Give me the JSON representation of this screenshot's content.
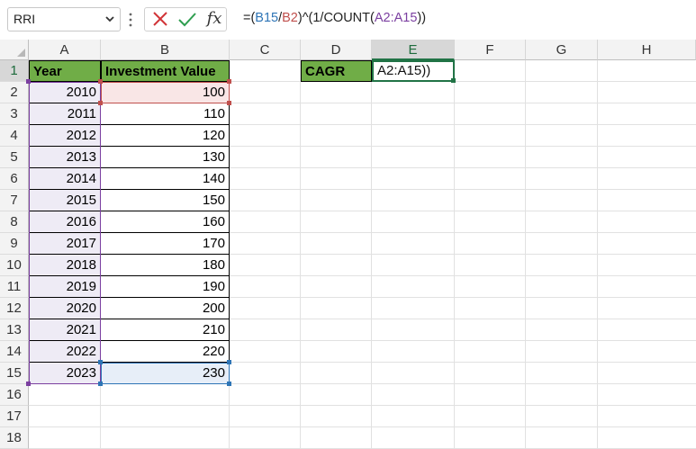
{
  "name_box": {
    "value": "RRI"
  },
  "formula_bar": {
    "fx_label": "fx",
    "formula_parts": [
      {
        "text": "=(",
        "color": "#222222"
      },
      {
        "text": "B15",
        "color": "#2e75b6"
      },
      {
        "text": "/",
        "color": "#222222"
      },
      {
        "text": "B2",
        "color": "#c0504d"
      },
      {
        "text": ")^(1/COUNT(",
        "color": "#222222"
      },
      {
        "text": "A2:A15",
        "color": "#7b3fa0"
      },
      {
        "text": "))",
        "color": "#222222"
      }
    ]
  },
  "columns": [
    "A",
    "B",
    "C",
    "D",
    "E",
    "F",
    "G",
    "H"
  ],
  "selected_column": "E",
  "rows": [
    "1",
    "2",
    "3",
    "4",
    "5",
    "6",
    "7",
    "8",
    "9",
    "10",
    "11",
    "12",
    "13",
    "14",
    "15",
    "16",
    "17",
    "18"
  ],
  "selected_row": "1",
  "table": {
    "headers": [
      "Year",
      "Investment Value"
    ],
    "years": [
      "2010",
      "2011",
      "2012",
      "2013",
      "2014",
      "2015",
      "2016",
      "2017",
      "2018",
      "2019",
      "2020",
      "2021",
      "2022",
      "2023"
    ],
    "values": [
      "100",
      "110",
      "120",
      "130",
      "140",
      "150",
      "160",
      "170",
      "180",
      "190",
      "200",
      "210",
      "220",
      "230"
    ]
  },
  "cagr": {
    "label": "CAGR",
    "edit_text": "A2:A15))"
  },
  "colors": {
    "header_green": "#70ad47",
    "b15_blue": "#2e75b6",
    "b2_red": "#c0504d",
    "range_purple": "#7b3fa0",
    "excel_green": "#217346"
  }
}
